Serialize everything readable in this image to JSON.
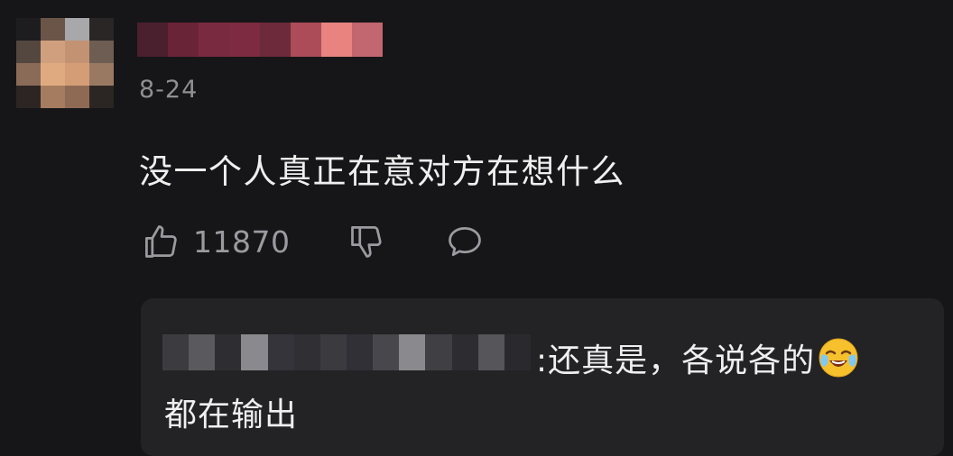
{
  "comment": {
    "date": "8-24",
    "text": "没一个人真正在意对方在想什么",
    "like_count": "11870",
    "icons": [
      "thumbs-up-icon",
      "thumbs-down-icon",
      "reply-bubble-icon"
    ]
  },
  "reply": {
    "line1": ":还真是，各说各的",
    "emoji": "crying-laughing-emoji",
    "line2": "都在输出"
  },
  "colors": {
    "background": "#161618",
    "reply_box": "#232326",
    "muted_text": "#8f8f94",
    "text": "#efefef"
  }
}
